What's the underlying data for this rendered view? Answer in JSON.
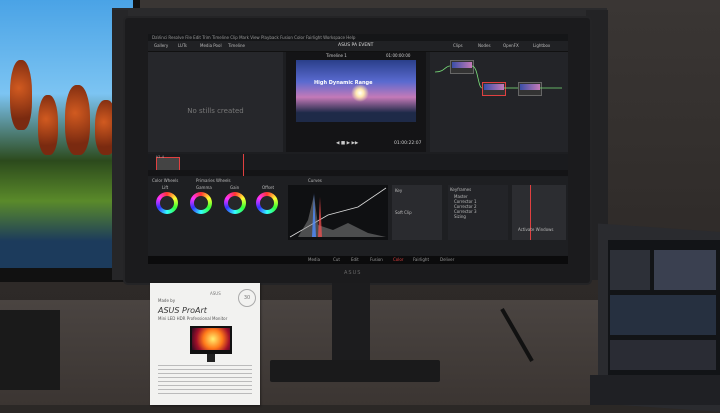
{
  "scene": {
    "description_free": true
  },
  "app": {
    "menu": "DaVinci Resolve   File   Edit   Trim   Timeline   Clip   Mark   View   Playback   Fusion   Color   Fairlight   Workspace   Help",
    "project_title": "ASUS PA EVENT",
    "timeline_name": "Timeline 1",
    "toolbar_left": [
      "Gallery",
      "LUTs",
      "Media Pool",
      "Timeline"
    ],
    "toolbar_right": [
      "Clips",
      "Nodes",
      "OpenFX",
      "Lightbox"
    ],
    "timecode": "01:00:22:07",
    "viewer_timecode": "01:00:00:00",
    "gallery_message": "No stills created",
    "preview_title": "High Dynamic Range",
    "clip_label": "V1.4",
    "color_wheels_label": "Color Wheels",
    "primaries_label": "Primaries Wheels",
    "curves_label": "Curves",
    "wheels": [
      "Lift",
      "Gamma",
      "Gain",
      "Offset"
    ],
    "nodes_label": "Keyframes",
    "node_items": [
      "Master",
      "Corrector 1",
      "Corrector 2",
      "Corrector 3",
      "Sizing"
    ],
    "side_labels": [
      "Key",
      "Shrink",
      "Soft Clip"
    ],
    "page_tabs": [
      "Media",
      "Cut",
      "Edit",
      "Fusion",
      "Color",
      "Fairlight",
      "Deliver"
    ],
    "activate_windows": "Activate Windows"
  },
  "monitor_brand": "ASUS",
  "leaflet": {
    "top": "Made by",
    "title": "ASUS ProArt",
    "subtitle": "Mini LED HDR Professional Monitor",
    "badge": "30",
    "brand_small": "ASUS"
  },
  "colors": {
    "accent_red": "#e04040",
    "bezel": "#1b1b1d"
  }
}
